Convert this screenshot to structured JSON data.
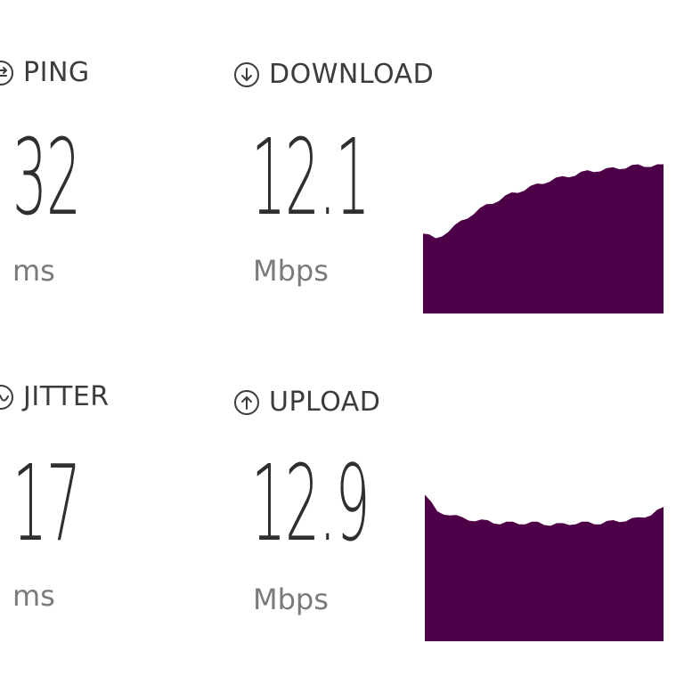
{
  "colors": {
    "graph_fill": "#4d0048",
    "text_primary": "#2f2f2f",
    "text_unit": "#7a7a7a"
  },
  "metrics": {
    "ping": {
      "label": "PING",
      "value": "32",
      "unit": "ms",
      "icon": "ping-arrows-icon"
    },
    "download": {
      "label": "DOWNLOAD",
      "value": "12.1",
      "unit": "Mbps",
      "icon": "download-arrow-icon"
    },
    "jitter": {
      "label": "JITTER",
      "value": "17",
      "unit": "ms",
      "icon": "wave-icon"
    },
    "upload": {
      "label": "UPLOAD",
      "value": "12.9",
      "unit": "Mbps",
      "icon": "upload-arrow-icon"
    }
  },
  "graphs": {
    "download_trend": [
      0.55,
      0.5,
      0.56,
      0.62,
      0.68,
      0.73,
      0.77,
      0.81,
      0.84,
      0.87,
      0.9,
      0.92,
      0.94,
      0.96,
      0.97,
      0.98,
      0.99,
      1.0,
      1.0,
      1.0
    ],
    "upload_trend": [
      1.0,
      0.87,
      0.86,
      0.83,
      0.82,
      0.81,
      0.8,
      0.8,
      0.8,
      0.8,
      0.79,
      0.79,
      0.8,
      0.8,
      0.8,
      0.81,
      0.82,
      0.83,
      0.86,
      0.9
    ]
  }
}
